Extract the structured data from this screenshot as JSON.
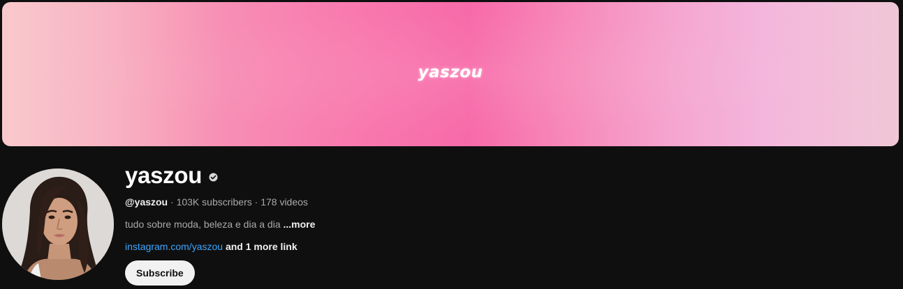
{
  "banner": {
    "text": "yaszou"
  },
  "channel": {
    "name": "yaszou",
    "verified_icon": "verified-check-icon",
    "handle": "@yaszou",
    "separator": " · ",
    "subscribers": "103K subscribers",
    "videos": "178 videos",
    "description": "tudo sobre moda, beleza e dia a dia ",
    "more_label": "...more",
    "link_text": "instagram.com/yaszou",
    "more_links_text": " and 1 more link"
  },
  "actions": {
    "subscribe_label": "Subscribe"
  },
  "colors": {
    "background": "#0f0f0f",
    "link": "#3ea6ff",
    "banner_pink": "#f76aa9"
  }
}
